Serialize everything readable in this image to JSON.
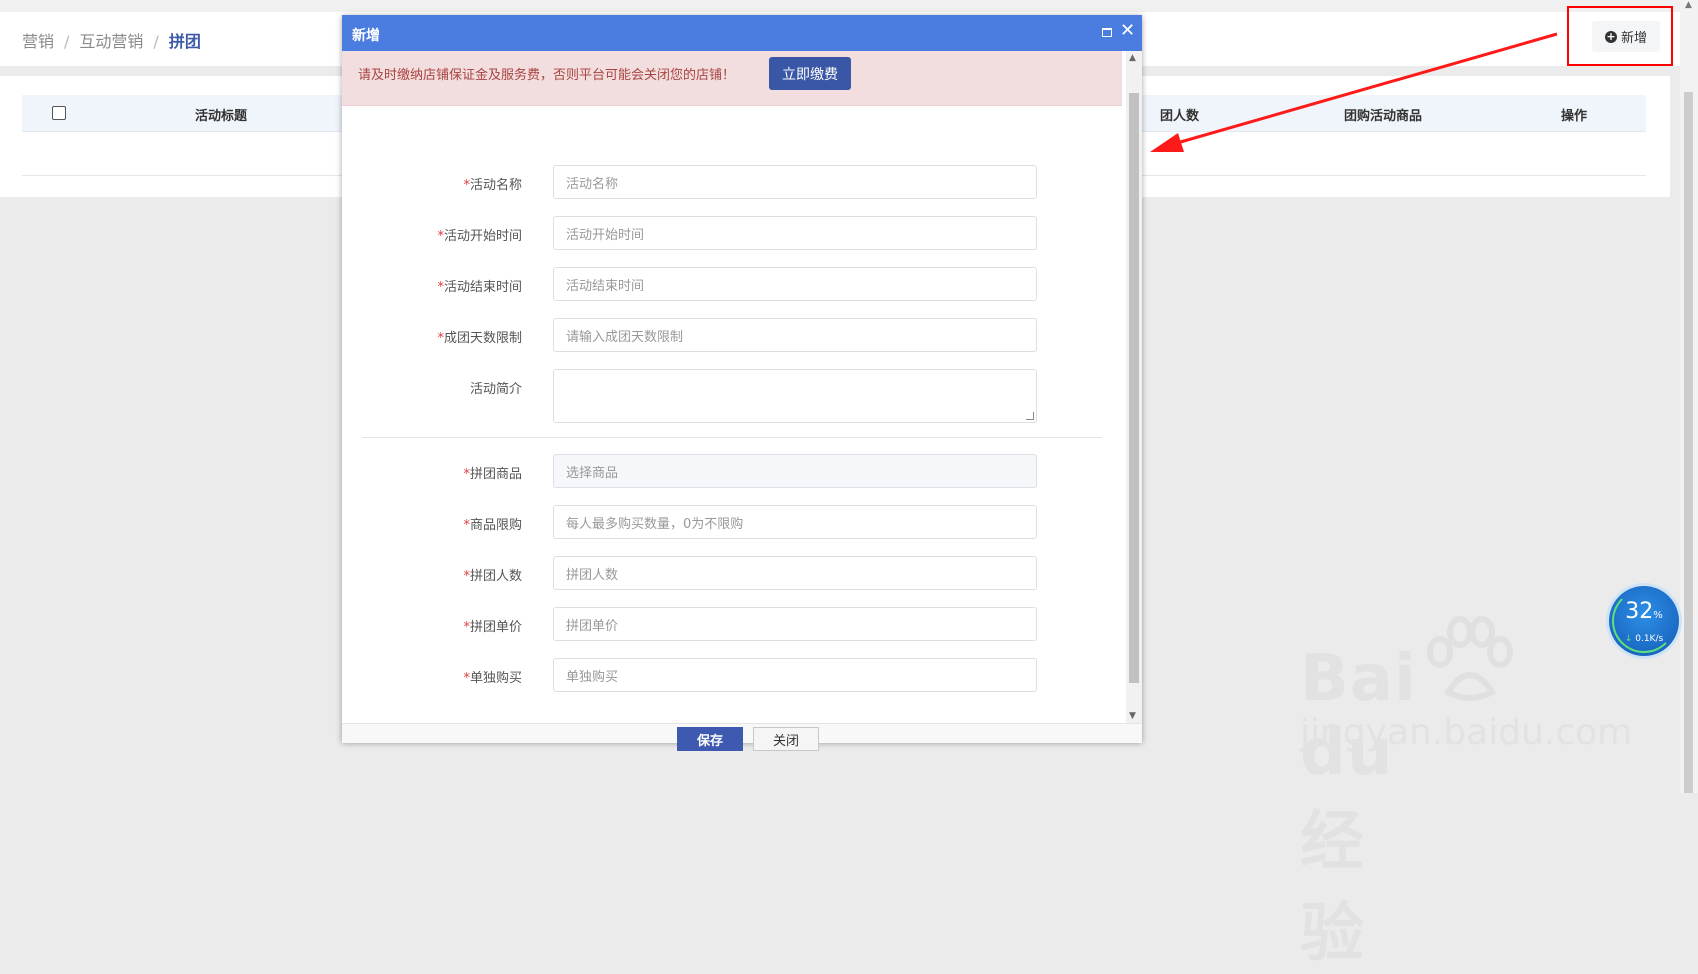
{
  "breadcrumb": {
    "items": [
      "营销",
      "互动营销"
    ],
    "current": "拼团"
  },
  "toolbar": {
    "add_label": "新增"
  },
  "table": {
    "columns": {
      "title": "活动标题",
      "group_size": "团人数",
      "products": "团购活动商品",
      "actions": "操作"
    }
  },
  "modal": {
    "title": "新增",
    "notice": "请及时缴纳店铺保证金及服务费，否则平台可能会关闭您的店铺！",
    "pay_label": "立即缴费",
    "fields": {
      "activity_name": {
        "label": "活动名称",
        "placeholder": "活动名称"
      },
      "start_time": {
        "label": "活动开始时间",
        "placeholder": "活动开始时间"
      },
      "end_time": {
        "label": "活动结束时间",
        "placeholder": "活动结束时间"
      },
      "day_limit": {
        "label": "成团天数限制",
        "placeholder": "请输入成团天数限制"
      },
      "intro": {
        "label": "活动简介"
      },
      "product": {
        "label": "拼团商品",
        "placeholder": "选择商品"
      },
      "purchase_limit": {
        "label": "商品限购",
        "placeholder": "每人最多购买数量，0为不限购"
      },
      "group_size": {
        "label": "拼团人数",
        "placeholder": "拼团人数"
      },
      "group_price": {
        "label": "拼团单价",
        "placeholder": "拼团单价"
      },
      "single_price": {
        "label": "单独购买",
        "placeholder": "单独购买"
      }
    },
    "required_mark": "*",
    "save_label": "保存",
    "close_label": "关闭"
  },
  "speed_widget": {
    "percent": "32",
    "percent_unit": "%",
    "rate": "0.1K/s"
  },
  "watermark": {
    "logo": "Bai du 经验",
    "url": "jingyan.baidu.com"
  },
  "colors": {
    "accent": "#3d5ab0",
    "titlebar": "#4b7de0",
    "required": "#e4393c",
    "annotation": "#ff0000"
  }
}
